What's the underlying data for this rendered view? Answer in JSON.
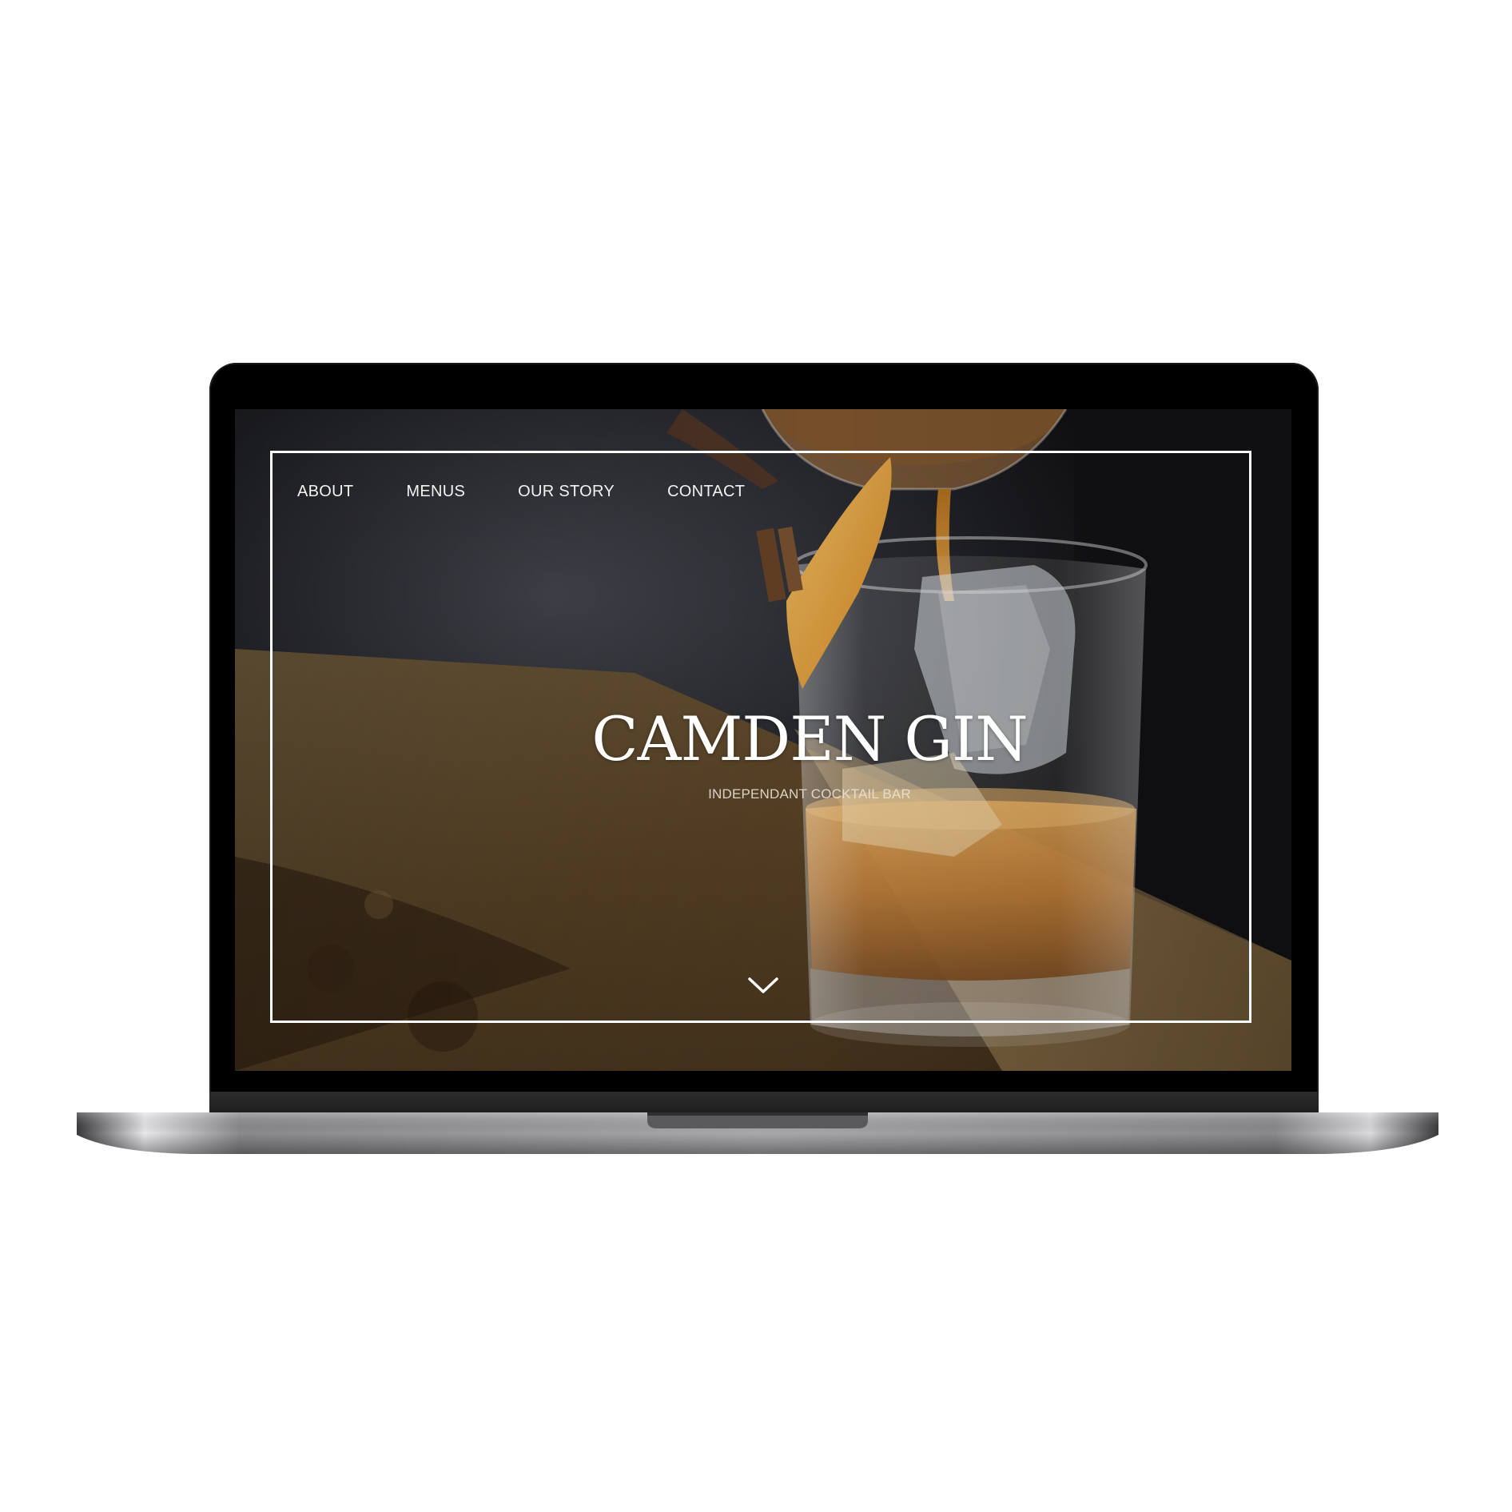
{
  "nav": {
    "items": [
      {
        "label": "ABOUT"
      },
      {
        "label": "MENUS"
      },
      {
        "label": "OUR STORY"
      },
      {
        "label": "CONTACT"
      }
    ]
  },
  "hero": {
    "title": "CAMDEN GIN",
    "subtitle": "INDEPENDANT COCKTAIL BAR"
  },
  "icons": {
    "scroll": "chevron-down-icon"
  },
  "colors": {
    "frame": "#ffffff",
    "bezel": "#000000",
    "whisky": "#c98a3a",
    "background": "#1b1b1f"
  }
}
